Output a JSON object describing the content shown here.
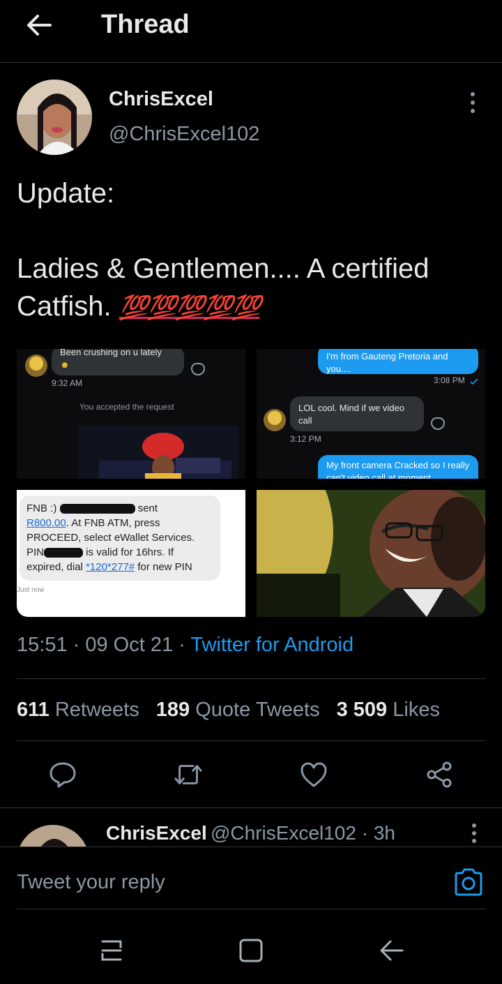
{
  "header": {
    "title": "Thread",
    "back_icon": "arrow-left-icon"
  },
  "tweet": {
    "author_name": "ChrisExcel",
    "author_handle": "@ChrisExcel102",
    "text_line1": "Update:",
    "text_line2": "Ladies & Gentlemen.... A certified",
    "text_line3_word": "Catfish.",
    "emoji_label": "💯💯💯💯💯",
    "media": {
      "chat": {
        "incoming_text": "Been crushing on u lately",
        "incoming_time": "9:32 AM",
        "system_text": "You accepted the request"
      },
      "dm": {
        "outgoing_text_top": "I'm from Gauteng Pretoria and you....",
        "outgoing_time": "3:08 PM",
        "incoming_text": "LOL cool. Mind if we video call",
        "incoming_time": "3:12 PM",
        "outgoing_text_bottom": "My front camera Cracked so I really can't video call at moment"
      },
      "sms": {
        "line1_pre": "FNB :)",
        "line1_post": "sent",
        "amount": "R800.00",
        "line2_post": ". At FNB ATM, press",
        "line3": "PROCEED, select eWallet Services.",
        "line4_pre": "PIN",
        "line4_post": "is valid for 16hrs. If",
        "line5_pre": "expired, dial",
        "ussd": "*120*277#",
        "line5_post": "for new PIN",
        "time": "Just now"
      }
    },
    "time": "15:51",
    "date": "09 Oct 21",
    "source": "Twitter for Android"
  },
  "stats": {
    "retweets_count": "611",
    "retweets_label": "Retweets",
    "quotes_count": "189",
    "quotes_label": "Quote Tweets",
    "likes_count": "3 509",
    "likes_label": "Likes"
  },
  "actions": [
    "reply-icon",
    "retweet-icon",
    "like-icon",
    "share-icon"
  ],
  "reply_preview": {
    "name": "ChrisExcel",
    "handle_time": "@ChrisExcel102 · 3h"
  },
  "composer": {
    "placeholder": "Tweet your reply",
    "camera_icon": "camera-icon"
  },
  "android_nav": [
    "recents-icon",
    "home-icon",
    "back-icon"
  ],
  "colors": {
    "accent": "#1d9bf0",
    "background": "#000000",
    "secondary_text": "#8b98a5",
    "emoji_red": "#e0245e"
  }
}
